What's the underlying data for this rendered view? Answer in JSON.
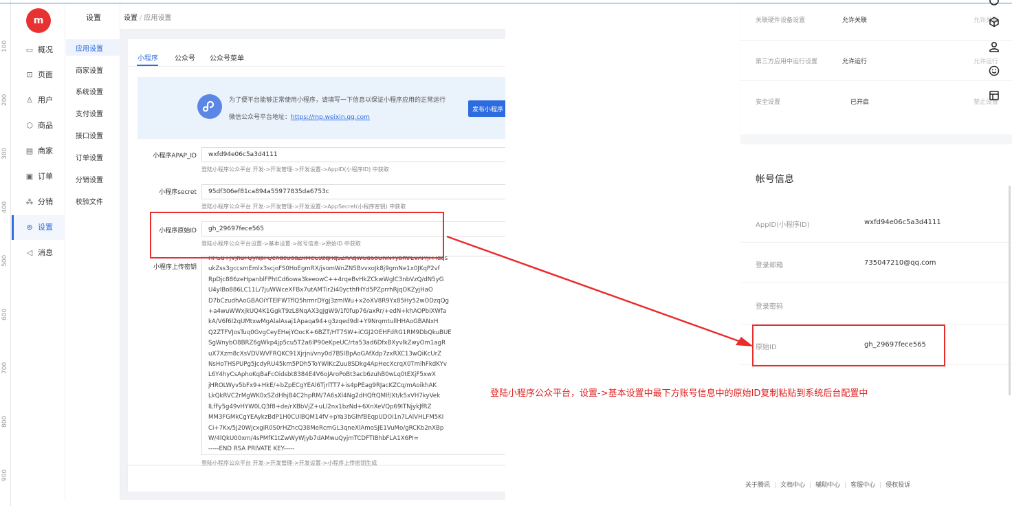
{
  "ruler": [
    "100",
    "200",
    "300",
    "400",
    "500",
    "600",
    "700",
    "800",
    "900"
  ],
  "logo": "m",
  "nav": {
    "items": [
      {
        "icon": "▭",
        "label": "概况"
      },
      {
        "icon": "⊡",
        "label": "页面"
      },
      {
        "icon": "♙",
        "label": "用户"
      },
      {
        "icon": "⬡",
        "label": "商品"
      },
      {
        "icon": "▤",
        "label": "商家"
      },
      {
        "icon": "▣",
        "label": "订单"
      },
      {
        "icon": "⁂",
        "label": "分销"
      },
      {
        "icon": "⊚",
        "label": "设置"
      },
      {
        "icon": "◁",
        "label": "消息"
      }
    ],
    "active": "设置"
  },
  "subnav": {
    "title": "设置",
    "items": [
      "应用设置",
      "商家设置",
      "系统设置",
      "支付设置",
      "接口设置",
      "订单设置",
      "分销设置",
      "校验文件"
    ]
  },
  "breadcrumb": {
    "root": "设置",
    "sep": "/",
    "current": "应用设置"
  },
  "tabs": [
    "小程序",
    "公众号",
    "公众号菜单"
  ],
  "notice": {
    "text": "为了便平台能够正常使用小程序，请填写一下信息以保证小程序应用的正常运行",
    "url_label": "微信公众号平台地址：",
    "url": "https://mp.weixin.qq.com",
    "publish_button": "发布小程序"
  },
  "form": {
    "appid": {
      "label": "小程序APAP_ID",
      "value": "wxfd94e06c5a3d4111",
      "hint": "登陆小程序公众平台 开发->开发管理->开发设置->AppID(小程序ID) 中获取"
    },
    "secret": {
      "label": "小程序secret",
      "value": "95df306ef81ca894a55977835da6753c",
      "hint": "登陆小程序公众平台 开发->开发管理->开发设置->AppSecret(小程序密钥) 中获取"
    },
    "origin_id": {
      "label": "小程序原始ID",
      "value": "gh_29697fece565",
      "hint": "登陆小程序公众平台设置->基本设置->账号信息->原始ID 中获取"
    },
    "upload_key": {
      "label": "小程序上传密钥",
      "lines": [
        "HFGu+jVjnuFQyNpFQehdcUodZkMeC9zqHqSZnAqWOa6oONNYybmrEvAP/ji+idqs",
        "ukZss3gccsmEmlx3scjoFS0HoEgmRX/jsomWnZN5BvvxoJk8j9gmNe1x0JKqP2vf",
        "RpDjc886zeHpanblFPhtCd6owa3keeowC++4rqeBvHkZCkwWglC3nbVzQ/dN5yG",
        "U4ylBo886LC11L/7juWWceXFBx7utAMTir2i40ycthfHYd5PZprrhRjqOKZyjHaO",
        "D7bCzudhAoGBAOiYTElFWTflQ5hrmrDYgj3zmIWu+x2oXV8R9Yx85Hy52wODzqQg",
        "+a4wuWWxjkUQ4K1GgkT9zL8NqAX3gJgW9/1f0fup76/axRr/+edN+khAOPbiXWfa",
        "kA/V6f6I2qUMtxwMgAlalAsaj1Apaqa94+g3zqed9dI+Y9NrqmtullHHAoGBANxH",
        "Q2ZTFVJosTuq0GvgCeyEHejYOocK+6BZT/HT7SW+iCGJ2OEHFdRG1RM9DbQkuBUE",
        "SgWnybO8BRZ6gWkp4jp5cu5T2a6lP90eKpeUC/rta53ad6DfxBXyvlkZwyOm1agR",
        "uX7Xzm8cXsVDVWVFRQKC91Xjrjni/vny0d7BSIBpAoGAfXdp7zxRXC13wQiKcUrZ",
        "NsHoTHSPUPg5JcdyRU45km5PDh5ToYWIKcZuu8SDkg4ApHecXcrqX0TmlhFkdKYv",
        "L6Y4hyCsAphoKqBaFcOidsbt8384E4V6oJAroPoBt3acb6zuhB0wLq0tEXjF5xwX",
        "jHROLWyv5bFx9+HkE/+bZpECgYEAl6TjrlTT7+is4pPEag9RJacKZCq/mAoikhAK",
        "LkQkRVC2rMgWK0xSZdHhjB4C2hpRM/7A6sXl4Ng2dHQftQMlf/Xt/k5xVH7kyVek",
        "ILfFy5g49vHYW0LQ3f8+de/rXBbVjZ+uLl2nx1bzNd+6XnXeVQp69ITNjykJfRZ",
        "MM3FGMkCgYEAykzBdP1H0CUlBQM14fV+pYa3bGlhfBEqpUDOi1n7LAlVHLFM5KI",
        "Ci+7Kx/5J20WjcxgiR0S0rHZhcQ38MeRcmGL3qneXlAmoSJE1VuMo/gRCKb2nXBp",
        "W/4lQkU00xm/4sPMfK1tZwWyWjyb7dAMwuQyjmTCDFTIBhbFLA1X6PI=",
        "-----END RSA PRIVATE KEY-----"
      ],
      "hint": "登陆小程序公众平台 开发->开发管理->开发设置->小程序上传密钥生成"
    }
  },
  "right_panel": {
    "settings": [
      {
        "label": "关联硬件设备设置",
        "value": "允许关联",
        "cut": "允许关联"
      },
      {
        "label": "第三方应用中运行设置",
        "value": "允许运行",
        "cut": "允许运行"
      },
      {
        "label": "安全设置",
        "value": "已开启",
        "cut": "禁止设置"
      }
    ],
    "account_title": "帐号信息",
    "account": [
      {
        "label": "AppID(小程序ID)",
        "value": "wxfd94e06c5a3d4111"
      },
      {
        "label": "登录邮箱",
        "value": "735047210@qq.com"
      },
      {
        "label": "登录密码",
        "value": ""
      },
      {
        "label": "原始ID",
        "value": "gh_29697fece565"
      }
    ],
    "footer_links": [
      "关于腾讯",
      "文档中心",
      "辅助中心",
      "客服中心",
      "侵权投诉"
    ]
  },
  "annotation": {
    "text": "登陆小程序公众平台，设置->基本设置中最下方账号信息中的原始ID复制粘贴到系统后台配置中",
    "color": "#e02020"
  }
}
